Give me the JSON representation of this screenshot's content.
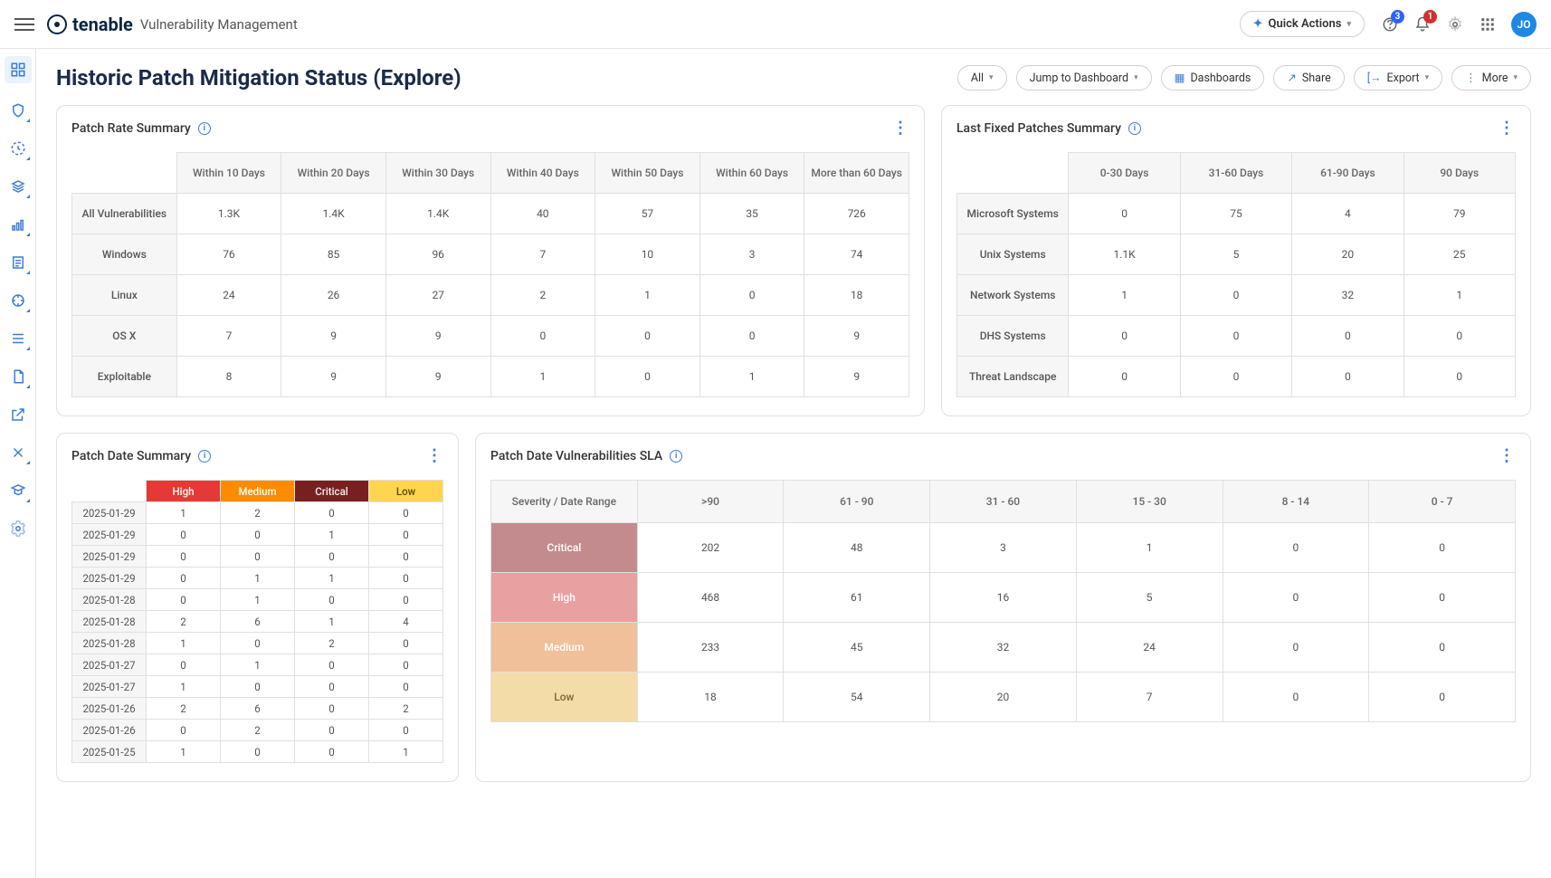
{
  "header": {
    "brand": "tenable",
    "product": "Vulnerability Management",
    "quick_actions": "Quick Actions",
    "badge_help": "3",
    "badge_bell": "1",
    "avatar": "JO"
  },
  "page": {
    "title": "Historic Patch Mitigation Status (Explore)",
    "toolbar": {
      "all": "All",
      "jump": "Jump to Dashboard",
      "dashboards": "Dashboards",
      "share": "Share",
      "export": "Export",
      "more": "More"
    }
  },
  "card_patch_rate": {
    "title": "Patch Rate Summary",
    "cols": [
      "Within 10 Days",
      "Within 20 Days",
      "Within 30 Days",
      "Within 40 Days",
      "Within 50 Days",
      "Within 60 Days",
      "More than 60 Days"
    ],
    "rows": [
      {
        "label": "All Vulnerabilities",
        "vals": [
          "1.3K",
          "1.4K",
          "1.4K",
          "40",
          "57",
          "35",
          "726"
        ]
      },
      {
        "label": "Windows",
        "vals": [
          "76",
          "85",
          "96",
          "7",
          "10",
          "3",
          "74"
        ]
      },
      {
        "label": "Linux",
        "vals": [
          "24",
          "26",
          "27",
          "2",
          "1",
          "0",
          "18"
        ]
      },
      {
        "label": "OS X",
        "vals": [
          "7",
          "9",
          "9",
          "0",
          "0",
          "0",
          "9"
        ]
      },
      {
        "label": "Exploitable",
        "vals": [
          "8",
          "9",
          "9",
          "1",
          "0",
          "1",
          "9"
        ]
      }
    ]
  },
  "card_last_fixed": {
    "title": "Last Fixed Patches Summary",
    "cols": [
      "0-30 Days",
      "31-60 Days",
      "61-90 Days",
      "90 Days"
    ],
    "rows": [
      {
        "label": "Microsoft Systems",
        "vals": [
          "0",
          "75",
          "4",
          "79"
        ]
      },
      {
        "label": "Unix Systems",
        "vals": [
          "1.1K",
          "5",
          "20",
          "25"
        ]
      },
      {
        "label": "Network Systems",
        "vals": [
          "1",
          "0",
          "32",
          "1"
        ]
      },
      {
        "label": "DHS Systems",
        "vals": [
          "0",
          "0",
          "0",
          "0"
        ]
      },
      {
        "label": "Threat Landscape",
        "vals": [
          "0",
          "0",
          "0",
          "0"
        ]
      }
    ]
  },
  "card_patch_date": {
    "title": "Patch Date Summary",
    "cols": [
      "High",
      "Medium",
      "Critical",
      "Low"
    ],
    "col_classes": [
      "sev-high",
      "sev-medium",
      "sev-critical",
      "sev-low"
    ],
    "rows": [
      {
        "label": "2025-01-29",
        "vals": [
          "1",
          "2",
          "0",
          "0"
        ]
      },
      {
        "label": "2025-01-29",
        "vals": [
          "0",
          "0",
          "1",
          "0"
        ]
      },
      {
        "label": "2025-01-29",
        "vals": [
          "0",
          "0",
          "0",
          "0"
        ]
      },
      {
        "label": "2025-01-29",
        "vals": [
          "0",
          "1",
          "1",
          "0"
        ]
      },
      {
        "label": "2025-01-28",
        "vals": [
          "0",
          "1",
          "0",
          "0"
        ]
      },
      {
        "label": "2025-01-28",
        "vals": [
          "2",
          "6",
          "1",
          "4"
        ]
      },
      {
        "label": "2025-01-28",
        "vals": [
          "1",
          "0",
          "2",
          "0"
        ]
      },
      {
        "label": "2025-01-27",
        "vals": [
          "0",
          "1",
          "0",
          "0"
        ]
      },
      {
        "label": "2025-01-27",
        "vals": [
          "1",
          "0",
          "0",
          "0"
        ]
      },
      {
        "label": "2025-01-26",
        "vals": [
          "2",
          "6",
          "0",
          "2"
        ]
      },
      {
        "label": "2025-01-26",
        "vals": [
          "0",
          "2",
          "0",
          "0"
        ]
      },
      {
        "label": "2025-01-25",
        "vals": [
          "1",
          "0",
          "0",
          "1"
        ]
      }
    ]
  },
  "card_sla": {
    "title": "Patch Date Vulnerabilities SLA",
    "corner": "Severity / Date Range",
    "cols": [
      ">90",
      "61 - 90",
      "31 - 60",
      "15 - 30",
      "8 - 14",
      "0 - 7"
    ],
    "rows": [
      {
        "label": "Critical",
        "cls": "sla-critical",
        "vals": [
          "202",
          "48",
          "3",
          "1",
          "0",
          "0"
        ]
      },
      {
        "label": "High",
        "cls": "sla-high",
        "vals": [
          "468",
          "61",
          "16",
          "5",
          "0",
          "0"
        ]
      },
      {
        "label": "Medium",
        "cls": "sla-medium",
        "vals": [
          "233",
          "45",
          "32",
          "24",
          "0",
          "0"
        ]
      },
      {
        "label": "Low",
        "cls": "sla-low",
        "vals": [
          "18",
          "54",
          "20",
          "7",
          "0",
          "0"
        ]
      }
    ]
  },
  "chart_data": {
    "type": "table",
    "note": "All four widgets are data tables; numeric data captured in card_* keys above."
  }
}
